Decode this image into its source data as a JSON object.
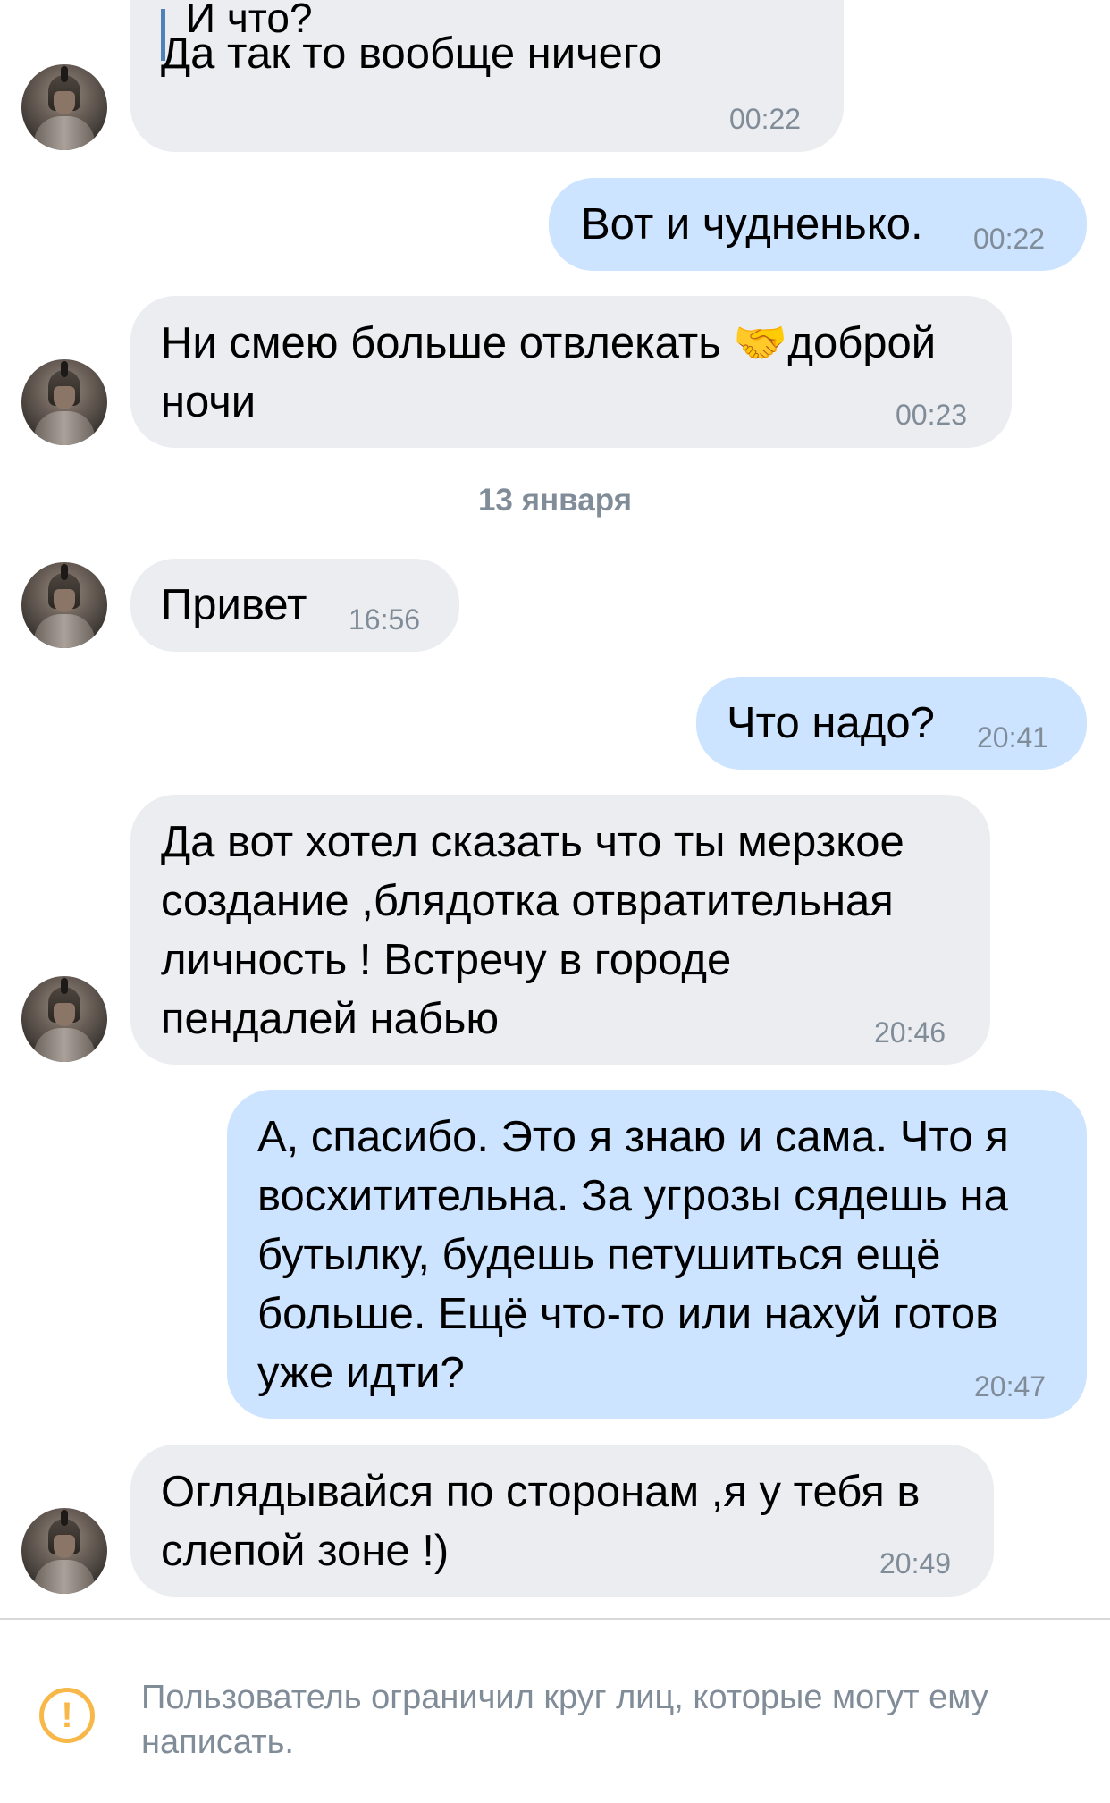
{
  "conversation": {
    "quoted_text": "И что?",
    "messages": [
      {
        "id": "m1",
        "direction": "incoming",
        "lines": [
          "Да так то вообще ничего"
        ],
        "time": "00:22"
      },
      {
        "id": "m2",
        "direction": "outgoing",
        "lines": [
          "Вот и чудненько."
        ],
        "time": "00:22"
      },
      {
        "id": "m3",
        "direction": "incoming",
        "lines": [
          "Ни смею больше отвлекать 🤝доброй",
          "ночи"
        ],
        "time": "00:23"
      },
      {
        "id": "m4",
        "direction": "incoming",
        "lines": [
          "Привет"
        ],
        "time": "16:56"
      },
      {
        "id": "m5",
        "direction": "outgoing",
        "lines": [
          "Что надо?"
        ],
        "time": "20:41"
      },
      {
        "id": "m6",
        "direction": "incoming",
        "lines": [
          "Да вот хотел сказать что ты мерзкое",
          "создание ,блядотка отвратительная",
          "личность ! Встречу в городе",
          "пендалей набью"
        ],
        "time": "20:46"
      },
      {
        "id": "m7",
        "direction": "outgoing",
        "lines": [
          "А, спасибо. Это я знаю и сама. Что я",
          "восхитительна. За угрозы сядешь на",
          "бутылку, будешь петушиться ещё",
          "больше. Ещё что-то или нахуй готов",
          "уже идти?"
        ],
        "time": "20:47"
      },
      {
        "id": "m8",
        "direction": "incoming",
        "lines": [
          "Оглядывайся по сторонам ,я у тебя в",
          "слепой зоне !)"
        ],
        "time": "20:49"
      }
    ],
    "date_separator": "13 января"
  },
  "footer": {
    "icon": "warning-icon",
    "notice": "Пользователь ограничил круг лиц, которые могут ему написать."
  },
  "colors": {
    "incoming_bubble": "#ebedf0",
    "outgoing_bubble": "#cce4ff",
    "timestamp": "#818c99",
    "warning": "#f8b849"
  }
}
